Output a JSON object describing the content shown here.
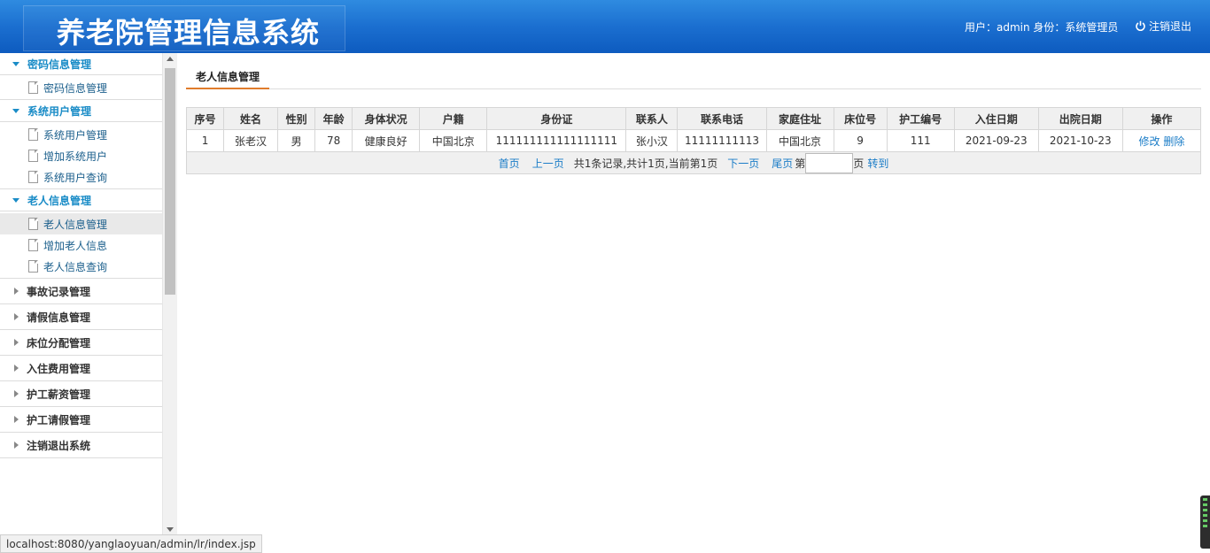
{
  "header": {
    "title": "养老院管理信息系统",
    "user_info": "用户：admin 身份：系统管理员",
    "logout_label": "注销退出"
  },
  "sidebar": {
    "groups": [
      {
        "label": "密码信息管理",
        "open": true,
        "items": [
          {
            "label": "密码信息管理"
          }
        ]
      },
      {
        "label": "系统用户管理",
        "open": true,
        "items": [
          {
            "label": "系统用户管理"
          },
          {
            "label": "增加系统用户"
          },
          {
            "label": "系统用户查询"
          }
        ]
      },
      {
        "label": "老人信息管理",
        "open": true,
        "items": [
          {
            "label": "老人信息管理",
            "active": true
          },
          {
            "label": "增加老人信息"
          },
          {
            "label": "老人信息查询"
          }
        ]
      },
      {
        "label": "事故记录管理",
        "open": false
      },
      {
        "label": "请假信息管理",
        "open": false
      },
      {
        "label": "床位分配管理",
        "open": false
      },
      {
        "label": "入住费用管理",
        "open": false
      },
      {
        "label": "护工薪资管理",
        "open": false
      },
      {
        "label": "护工请假管理",
        "open": false
      },
      {
        "label": "注销退出系统",
        "open": false
      }
    ]
  },
  "main": {
    "tab_label": "老人信息管理",
    "table": {
      "columns": [
        "序号",
        "姓名",
        "性别",
        "年龄",
        "身体状况",
        "户籍",
        "身份证",
        "联系人",
        "联系电话",
        "家庭住址",
        "床位号",
        "护工编号",
        "入住日期",
        "出院日期",
        "操作"
      ],
      "rows": [
        [
          "1",
          "张老汉",
          "男",
          "78",
          "健康良好",
          "中国北京",
          "111111111111111111",
          "张小汉",
          "11111111113",
          "中国北京",
          "9",
          "111",
          "2021-09-23",
          "2021-10-23"
        ]
      ],
      "actions": {
        "edit": "修改",
        "delete": "删除"
      }
    },
    "pager": {
      "first": "首页",
      "prev": "上一页",
      "summary": "共1条记录,共计1页,当前第1页",
      "next": "下一页",
      "last": "尾页",
      "page_prefix": "第",
      "page_input_value": "",
      "page_suffix": "页",
      "go": "转到"
    }
  },
  "statusbar": {
    "url": "localhost:8080/yanglaoyuan/admin/lr/index.jsp"
  }
}
